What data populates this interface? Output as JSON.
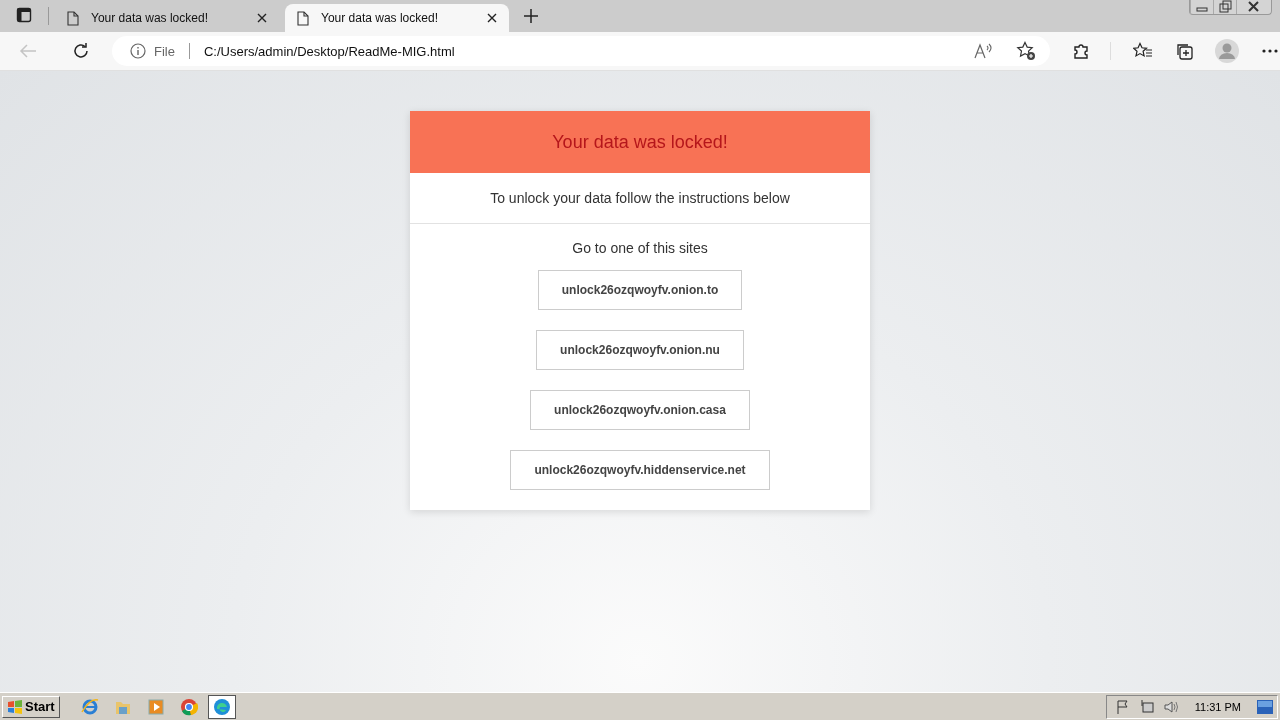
{
  "tabs": [
    {
      "title": "Your data was locked!",
      "selected": false
    },
    {
      "title": "Your data was locked!",
      "selected": true
    }
  ],
  "address": {
    "scheme": "File",
    "url": "C:/Users/admin/Desktop/ReadMe-MIG.html"
  },
  "note": {
    "title": "Your data was locked!",
    "subtitle": "To unlock your data follow the instructions below",
    "prompt": "Go to one of this sites",
    "links": [
      "unlock26ozqwoyfv.onion.to",
      "unlock26ozqwoyfv.onion.nu",
      "unlock26ozqwoyfv.onion.casa",
      "unlock26ozqwoyfv.hiddenservice.net"
    ]
  },
  "taskbar": {
    "start": "Start",
    "apps": [
      {
        "kind": "ie",
        "selected": false
      },
      {
        "kind": "folder",
        "selected": false
      },
      {
        "kind": "media",
        "selected": false
      },
      {
        "kind": "chrome",
        "selected": false
      },
      {
        "kind": "edge",
        "selected": true
      }
    ],
    "clock": "11:31 PM"
  }
}
